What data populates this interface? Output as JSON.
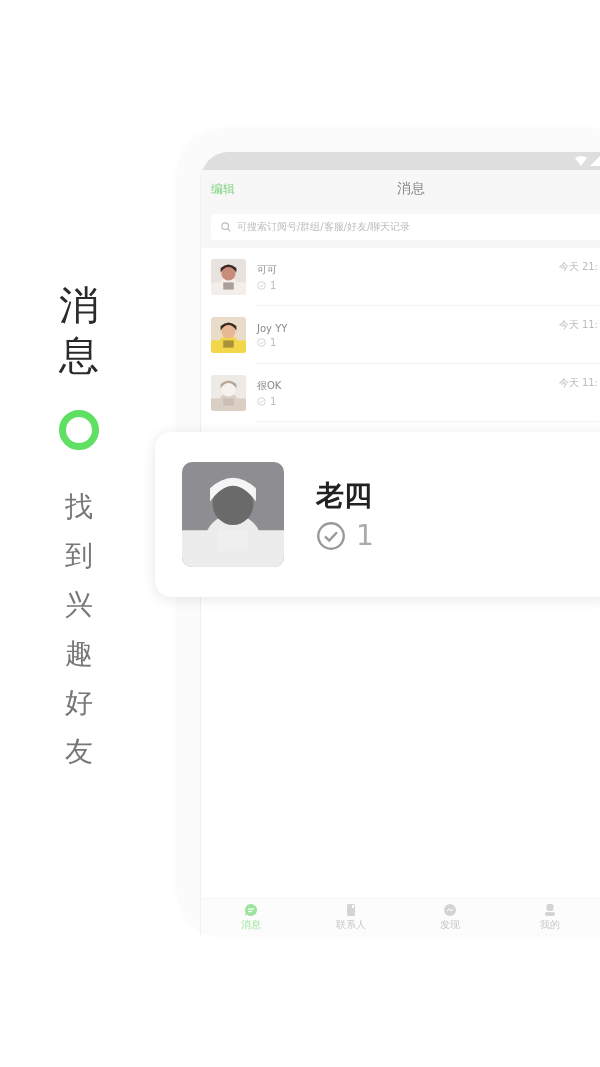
{
  "side": {
    "title": "消息",
    "subtitle": "找到兴趣好友"
  },
  "phone": {
    "header": {
      "edit": "编辑",
      "title": "消息"
    },
    "search": {
      "placeholder": "可搜索订阅号/群组/客服/好友/聊天记录"
    },
    "chats": [
      {
        "name": "可可",
        "count": "1",
        "time": "今天 21:"
      },
      {
        "name": "Joy YY",
        "count": "1",
        "time": "今天 11:"
      },
      {
        "name": "很OK",
        "count": "1",
        "time": "今天 11:"
      }
    ],
    "tabs": [
      {
        "label": "消息",
        "kind": "chat",
        "selected": true
      },
      {
        "label": "联系人",
        "kind": "contacts",
        "selected": false
      },
      {
        "label": "发现",
        "kind": "discover",
        "selected": false
      },
      {
        "label": "我的",
        "kind": "me",
        "selected": false
      }
    ]
  },
  "popup": {
    "name": "老四",
    "count": "1"
  }
}
